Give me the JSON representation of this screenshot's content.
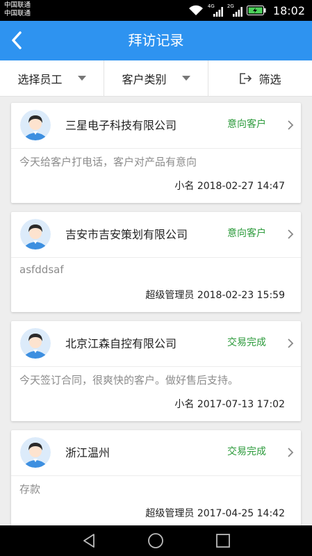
{
  "status_bar": {
    "carrier_1": "中国联通",
    "carrier_2": "中国联通",
    "net_1": "4G",
    "net_2": "2G",
    "time": "18:02"
  },
  "header": {
    "title": "拜访记录",
    "back_icon": "chevron-left-icon"
  },
  "filters": {
    "employee": "选择员工",
    "customer_type": "客户类别",
    "filter": "筛选"
  },
  "records": [
    {
      "company": "三星电子科技有限公司",
      "status": "意向客户",
      "note": "今天给客户打电话，客户对产品有意向",
      "author": "小名",
      "datetime": "2018-02-27 14:47"
    },
    {
      "company": "吉安市吉安策划有限公司",
      "status": "意向客户",
      "note": "asfddsaf",
      "author": "超级管理员",
      "datetime": "2018-02-23 15:59"
    },
    {
      "company": "北京江森自控有限公司",
      "status": "交易完成",
      "note": "今天签订合同，很爽快的客户。做好售后支持。",
      "author": "小名",
      "datetime": "2017-07-13 17:02"
    },
    {
      "company": "浙江温州",
      "status": "交易完成",
      "note": "存款",
      "author": "超级管理员",
      "datetime": "2017-04-25 14:42"
    }
  ],
  "colors": {
    "header_bg": "#2e93f0",
    "status_green": "#2d9b3c"
  }
}
